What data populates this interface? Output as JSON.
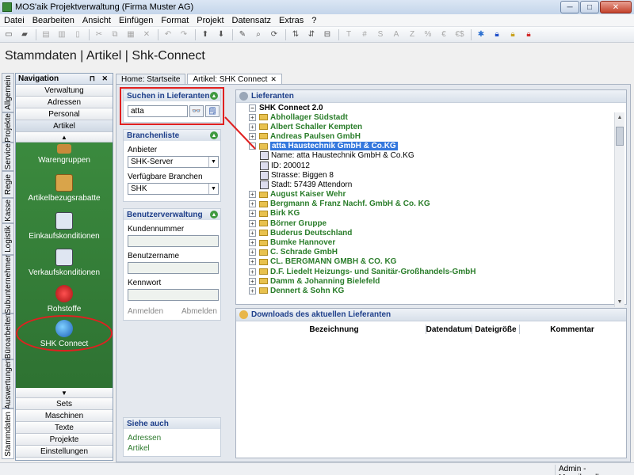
{
  "window": {
    "title": "MOS'aik Projektverwaltung (Firma Muster AG)",
    "minimize": "─",
    "maximize": "□",
    "close": "✕"
  },
  "menu": [
    "Datei",
    "Bearbeiten",
    "Ansicht",
    "Einfügen",
    "Format",
    "Projekt",
    "Datensatz",
    "Extras",
    "?"
  ],
  "toolbar_glyphs": [
    "T",
    "#",
    "S",
    "A",
    "Z",
    "%",
    "€",
    "€$"
  ],
  "page_title": "Stammdaten | Artikel | Shk-Connect",
  "vtabs": [
    "Allgemein",
    "Projekte",
    "Service",
    "Regie",
    "Kasse",
    "Logistik",
    "Subunternehmer",
    "Büroarbeiten",
    "Auswertungen",
    "Stammdaten"
  ],
  "nav": {
    "title": "Navigation",
    "pins": "⊓ ✕",
    "top_buttons": [
      "Verwaltung",
      "Adressen",
      "Personal",
      "Artikel"
    ],
    "up_arrow": "▲",
    "down_arrow": "▼",
    "items": [
      {
        "label": "Warengruppen",
        "icon": "warengruppen-icon"
      },
      {
        "label": "Artikelbezugsrabatte",
        "icon": "rabatte-icon"
      },
      {
        "label": "Einkaufskonditionen",
        "icon": "einkauf-icon"
      },
      {
        "label": "Verkaufskonditionen",
        "icon": "verkauf-icon"
      },
      {
        "label": "Rohstoffe",
        "icon": "rohstoffe-icon"
      },
      {
        "label": "SHK Connect",
        "icon": "globe-icon"
      }
    ],
    "bottom_buttons": [
      "Sets",
      "Maschinen",
      "Texte",
      "Projekte",
      "Einstellungen"
    ]
  },
  "tabs": [
    {
      "label": "Home: Startseite",
      "close": ""
    },
    {
      "label": "Artikel: SHK Connect",
      "close": "✕"
    }
  ],
  "search": {
    "title": "Suchen in Lieferanten",
    "value": "atta",
    "search_glyph": "👓",
    "clear_glyph": "🗒"
  },
  "branchen": {
    "title": "Branchenliste",
    "anbieter_label": "Anbieter",
    "anbieter_value": "SHK-Server",
    "branchen_label": "Verfügbare Branchen",
    "branchen_value": "SHK"
  },
  "benutzer": {
    "title": "Benutzerverwaltung",
    "kunden_label": "Kundennummer",
    "user_label": "Benutzername",
    "pw_label": "Kennwort",
    "anmelden": "Anmelden",
    "abmelden": "Abmelden"
  },
  "siehe": {
    "title": "Siehe auch",
    "links": [
      "Adressen",
      "Artikel"
    ]
  },
  "lieferanten": {
    "title": "Lieferanten",
    "root": "SHK Connect 2.0",
    "rows": [
      {
        "name": "Abhollager Südstadt",
        "exp": "+"
      },
      {
        "name": "Albert Schaller Kempten",
        "exp": "+"
      },
      {
        "name": "Andreas Paulsen GmbH",
        "exp": "+"
      },
      {
        "name": "atta Haustechnik GmbH & Co.KG",
        "exp": "−",
        "selected": true,
        "props": [
          "Name: atta Haustechnik GmbH & Co.KG",
          "ID: 200012",
          "Strasse: Biggen 8",
          "Stadt: 57439 Attendorn"
        ]
      },
      {
        "name": "August Kaiser Wehr",
        "exp": "+"
      },
      {
        "name": "Bergmann & Franz Nachf. GmbH & Co. KG",
        "exp": "+"
      },
      {
        "name": "Birk KG",
        "exp": "+"
      },
      {
        "name": "Börner Gruppe",
        "exp": "+"
      },
      {
        "name": "Buderus Deutschland",
        "exp": "+"
      },
      {
        "name": "Bumke Hannover",
        "exp": "+"
      },
      {
        "name": "C. Schrade GmbH",
        "exp": "+"
      },
      {
        "name": "CL. BERGMANN GMBH & CO. KG",
        "exp": "+"
      },
      {
        "name": "D.F. Liedelt Heizungs- und Sanitär-Großhandels-GmbH",
        "exp": "+"
      },
      {
        "name": "Damm & Johanning Bielefeld",
        "exp": "+"
      },
      {
        "name": "Dennert & Sohn KG",
        "exp": "+"
      }
    ]
  },
  "downloads": {
    "title": "Downloads des aktuellen Lieferanten",
    "columns": [
      "Bezeichnung",
      "Datendatum",
      "Dateigröße",
      "Kommentar"
    ]
  },
  "status": {
    "user": "Admin - Mosaik.mdb"
  },
  "colors": {
    "accent_green": "#2e7d32",
    "highlight_red": "#e02020",
    "selection_blue": "#3377dd"
  }
}
